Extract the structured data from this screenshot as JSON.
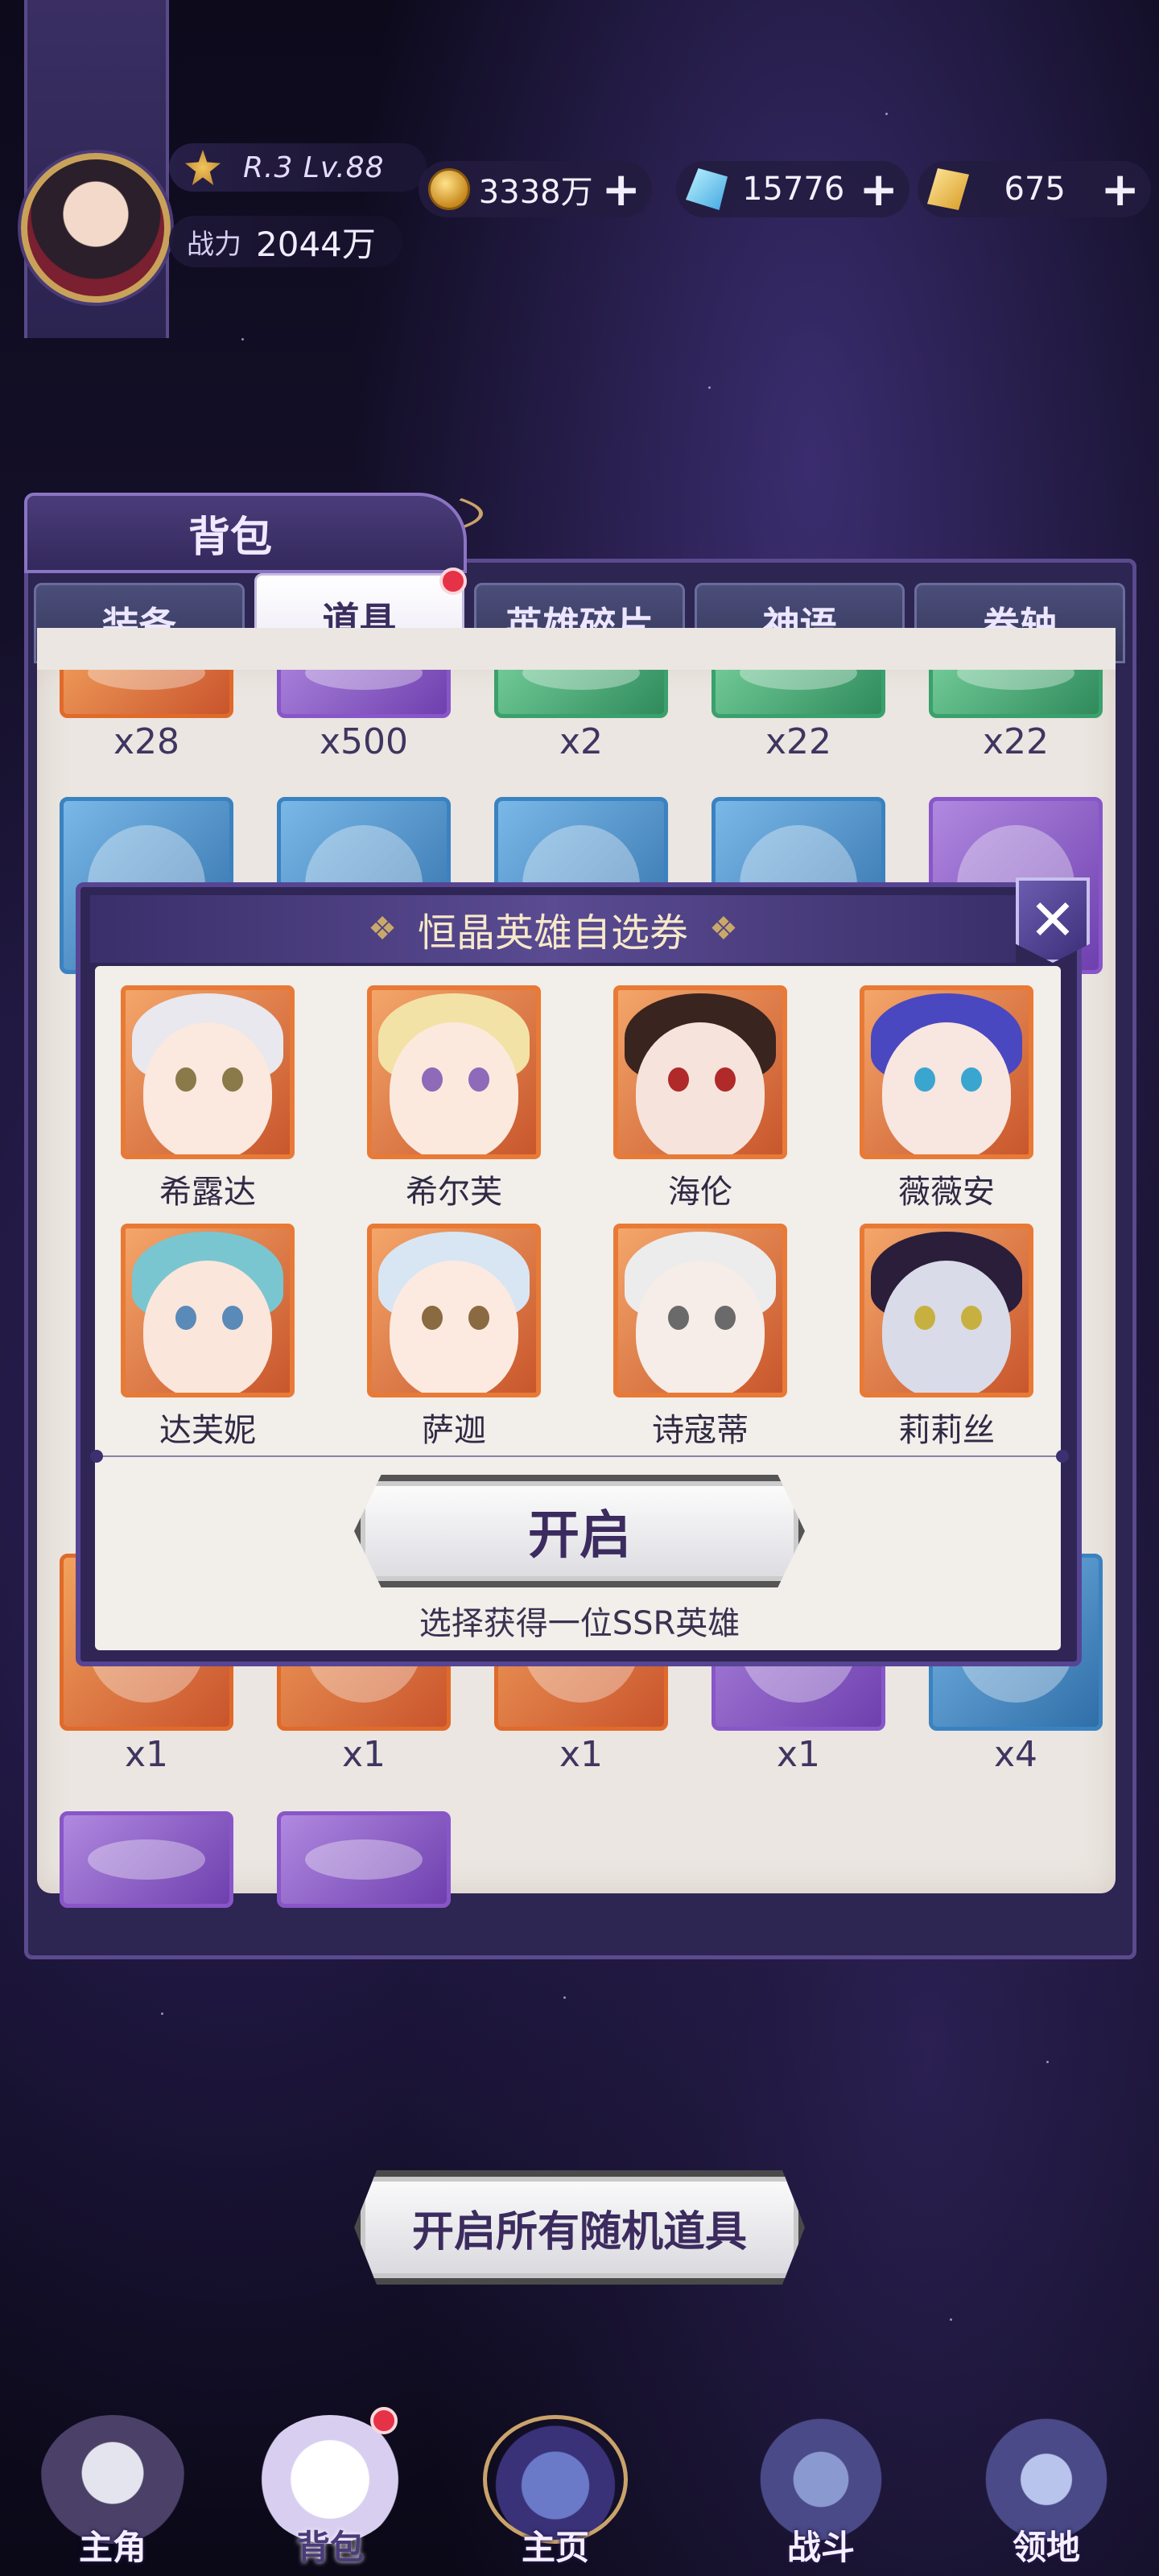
{
  "player": {
    "level_text": "R.3 Lv.88",
    "power_label": "战力",
    "power_value": "2044万"
  },
  "resources": [
    {
      "icon": "gold-coin-icon",
      "value": "3338万"
    },
    {
      "icon": "blue-crystal-icon",
      "value": "15776"
    },
    {
      "icon": "gold-gem-icon",
      "value": "675"
    }
  ],
  "bag": {
    "title": "背包",
    "tabs": [
      "装备",
      "道具",
      "英雄碎片",
      "神语",
      "卷轴"
    ],
    "active_tab": "道具",
    "row1_counts": [
      "x28",
      "x500",
      "x2",
      "x22",
      "x22"
    ],
    "row_bottom_counts": [
      "x1",
      "x1",
      "x1",
      "x1",
      "x4"
    ]
  },
  "modal": {
    "title": "恒晶英雄自选券",
    "heroes": [
      "希露达",
      "希尔芙",
      "海伦",
      "薇薇安",
      "达芙妮",
      "萨迦",
      "诗寇蒂",
      "莉莉丝"
    ],
    "open_button": "开启",
    "hint": "选择获得一位SSR英雄"
  },
  "open_all_button": "开启所有随机道具",
  "nav": [
    "主角",
    "背包",
    "主页",
    "战斗",
    "领地"
  ],
  "colors": {
    "accent": "#5a4b92",
    "badge": "#e63246",
    "rarity_orange": "#e06a2a",
    "rarity_purple": "#8856c8"
  }
}
